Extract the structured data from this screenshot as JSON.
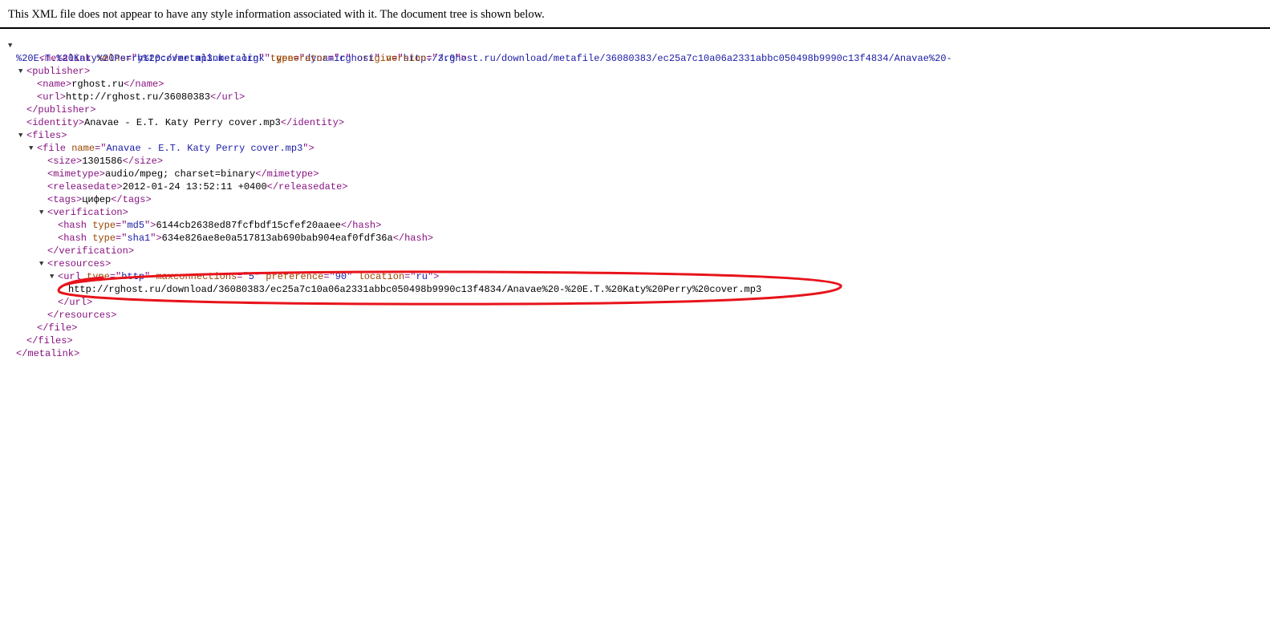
{
  "header": {
    "notice": "This XML file does not appear to have any style information associated with it. The document tree is shown below."
  },
  "xml": {
    "metalink": {
      "xmlns": "http://metalinker.org",
      "type": "dynamic",
      "origin_line1": "http://rghost.ru/download/metafile/36080383/ec25a7c10a06a2331abbc050498b9990c13f4834/Anavae%20-",
      "origin_line2": "%20E.T.%20Katy%20Perry%20cover.mp3.metalink",
      "generator": "rghost",
      "version": "3.0"
    },
    "publisher": {
      "name": "rghost.ru",
      "url": "http://rghost.ru/36080383"
    },
    "identity": "Anavae - E.T. Katy Perry cover.mp3",
    "file": {
      "name": "Anavae - E.T. Katy Perry cover.mp3",
      "size": "1301586",
      "mimetype": "audio/mpeg; charset=binary",
      "releasedate": "2012-01-24 13:52:11 +0400",
      "tags": "цифер",
      "verification": {
        "md5_type": "md5",
        "md5_value": "6144cb2638ed87fcfbdf15cfef20aaee",
        "sha1_type": "sha1",
        "sha1_value": "634e826ae8e0a517813ab690bab904eaf0fdf36a"
      },
      "resource": {
        "type": "http",
        "maxconnections": "5",
        "preference": "90",
        "location": "ru",
        "url": "http://rghost.ru/download/36080383/ec25a7c10a06a2331abbc050498b9990c13f4834/Anavae%20-%20E.T.%20Katy%20Perry%20cover.mp3"
      }
    }
  },
  "colors": {
    "tag": "#881280",
    "attr_name": "#994500",
    "attr_value": "#1a1aa6",
    "highlight": "#e8131b"
  },
  "icons": {
    "toggle": "triangle-down-icon"
  }
}
